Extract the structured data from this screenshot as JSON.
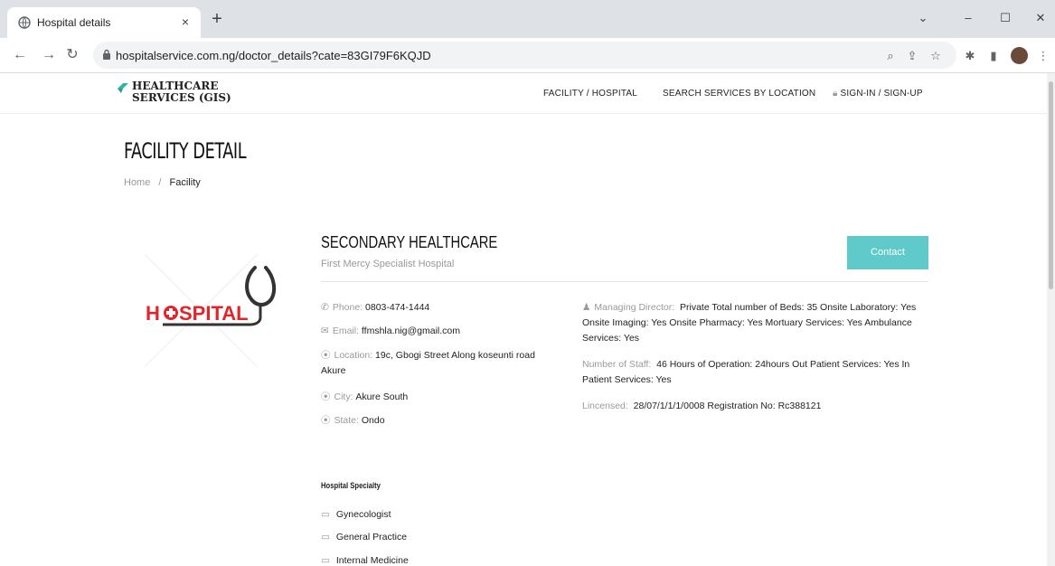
{
  "browser": {
    "tab_title": "Hospital details",
    "tab_close": "×",
    "new_tab": "+",
    "url": "hospitalservice.com.ng/doctor_details?cate=83GI79F6KQJD",
    "win_buttons": [
      "⌄",
      "–",
      "☐",
      "✕"
    ]
  },
  "site": {
    "logo_line1": "HEALTHCARE",
    "logo_line2": "SERVICES (GIS)",
    "nav": {
      "facility": "FACILITY / HOSPITAL",
      "search": "SEARCH SERVICES BY LOCATION",
      "signin": "SIGN-IN / SIGN-UP"
    }
  },
  "page": {
    "title": "FACILITY DETAIL",
    "breadcrumb": {
      "home": "Home",
      "sep": "/",
      "current": "Facility"
    }
  },
  "facility": {
    "logo_text_h": "H",
    "logo_text_rest": "SPITAL",
    "type": "SECONDARY HEALTHCARE",
    "name": "First Mercy Specialist Hospital",
    "contact_label": "Contact",
    "phone_label": "Phone:",
    "phone": "0803-474-1444",
    "email_label": "Email:",
    "email": "ffmshla.nig@gmail.com",
    "location_label": "Location:",
    "location_line1": "19c, Gbogi Street Along koseunti road",
    "location_line2": "Akure",
    "city_label": "City:",
    "city": "Akure South",
    "state_label": "State:",
    "state": "Ondo",
    "md_label": "Managing Director:",
    "md_line1": "Private Total number of Beds: 35 Onsite Laboratory: Yes",
    "md_line2": "Onsite Imaging: Yes Onsite Pharmacy: Yes Mortuary Services: Yes Ambulance",
    "md_line3": "Services: Yes",
    "staff_label": "Number of Staff:",
    "staff_line1": "46 Hours of Operation: 24hours Out Patient Services: Yes In",
    "staff_line2": "Patient Services: Yes",
    "license_label": "Lincensed:",
    "license": "28/07/1/1/1/0008 Registration No: Rc388121"
  },
  "specialty": {
    "title": "Hospital Specialty",
    "items": [
      "Gynecologist",
      "General Practice",
      "Internal Medicine"
    ]
  },
  "colors": {
    "accent": "#5fcac9",
    "logo_red": "#e0262b",
    "logo_green": "#2fb7a6"
  }
}
